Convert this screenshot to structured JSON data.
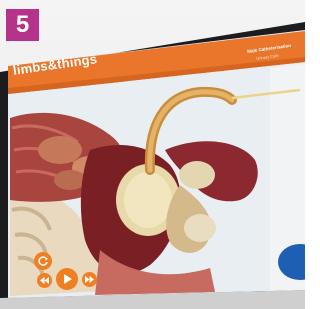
{
  "step_badge": "5",
  "app": {
    "brand": "limbs&things",
    "title": "Male Catheterisation",
    "subtitle": "Urinary Cath"
  },
  "icons": {
    "reset": "refresh-icon",
    "rewind": "rewind-icon",
    "play": "play-icon",
    "forward": "fast-forward-icon"
  },
  "colors": {
    "badge": "#b5338a",
    "header": "#e9762a",
    "controls": "#f07f22",
    "screen_bg": "#e8eef3"
  }
}
